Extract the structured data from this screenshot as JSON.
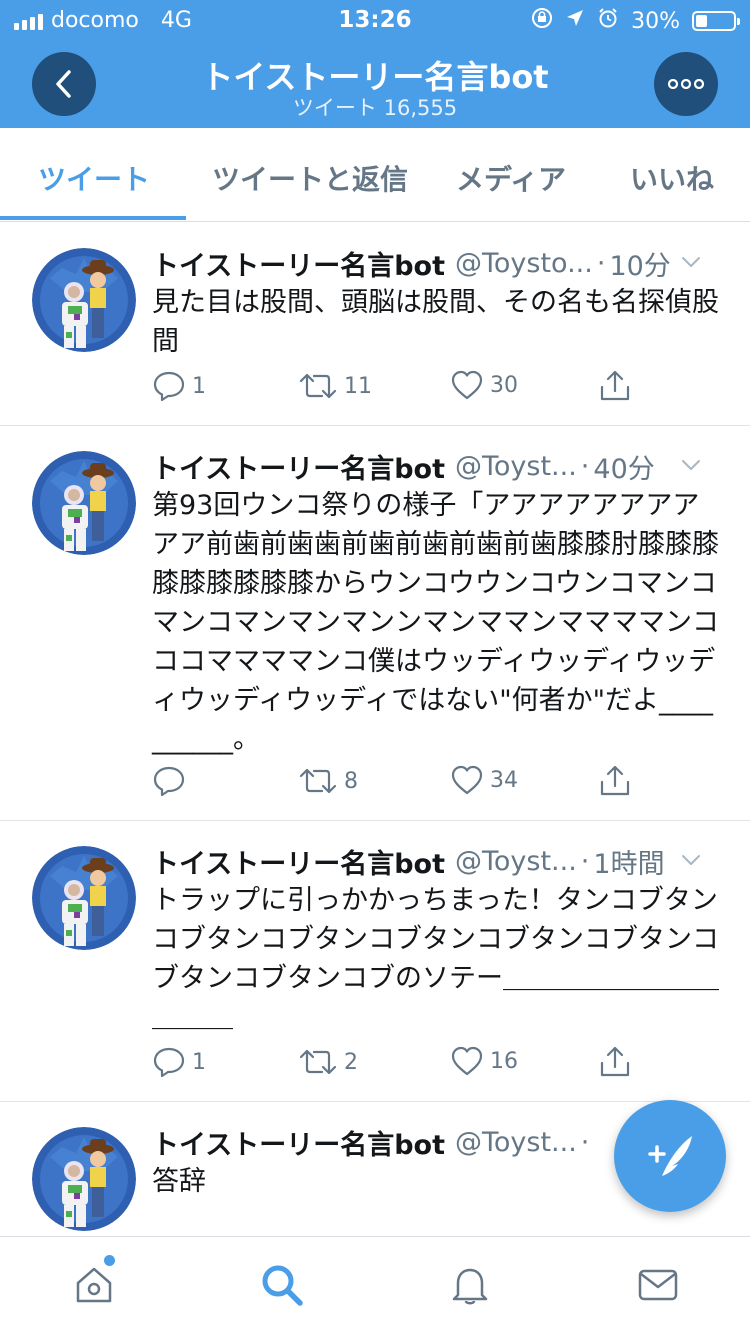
{
  "status_bar": {
    "carrier": "docomo",
    "network": "4G",
    "time": "13:26",
    "battery": "30%",
    "battery_level": 0.3
  },
  "nav": {
    "title": "トイストーリー名言bot",
    "subtitle": "ツイート 16,555"
  },
  "tabs": [
    {
      "label": "ツイート"
    },
    {
      "label": "ツイートと返信"
    },
    {
      "label": "メディア"
    },
    {
      "label": "いいね"
    }
  ],
  "tweets": [
    {
      "name": "トイストーリー名言bot",
      "handle": "@Toysto...",
      "time": "10分",
      "text": "見た目は股間、頭脳は股間、その名も名探偵股間",
      "replies": "1",
      "retweets": "11",
      "likes": "30"
    },
    {
      "name": "トイストーリー名言bot",
      "handle": "@Toyst...",
      "time": "40分",
      "text": "第93回ウンコ祭りの様子「アアアアアアアアアア前歯前歯歯前歯前歯前歯前歯膝膝肘膝膝膝膝膝膝膝膝膝からウンコウウンコウンコマンコマンコマンマンマンンマンママンママママンコココママママンコ僕はウッディウッディウッディウッディウッディではない\"何者か\"だよ__________。",
      "replies": "",
      "retweets": "8",
      "likes": "34"
    },
    {
      "name": "トイストーリー名言bot",
      "handle": "@Toyst...",
      "time": "1時間",
      "text": "トラップに引っかかっちまった！タンコブタンコブタンコブタンコブタンコブタンコブタンコブタンコブタンコブのソテー＿＿＿＿＿＿＿＿＿＿＿",
      "replies": "1",
      "retweets": "2",
      "likes": "16"
    },
    {
      "name": "トイストーリー名言bot",
      "handle": "@Toyst...",
      "time": "",
      "text": "答辞",
      "replies": "",
      "retweets": "",
      "likes": ""
    }
  ],
  "colors": {
    "brand_blue": "#4a9ee8",
    "nav_button": "#1f4f7a",
    "muted_text": "#657786"
  },
  "icons": {
    "back": "chevron-left-icon",
    "more": "more-dots-icon",
    "reply": "reply-icon",
    "retweet": "retweet-icon",
    "like": "heart-icon",
    "share": "share-icon",
    "compose": "compose-tweet-icon",
    "home": "home-icon",
    "search": "search-icon",
    "notifications": "bell-icon",
    "messages": "mail-icon"
  }
}
